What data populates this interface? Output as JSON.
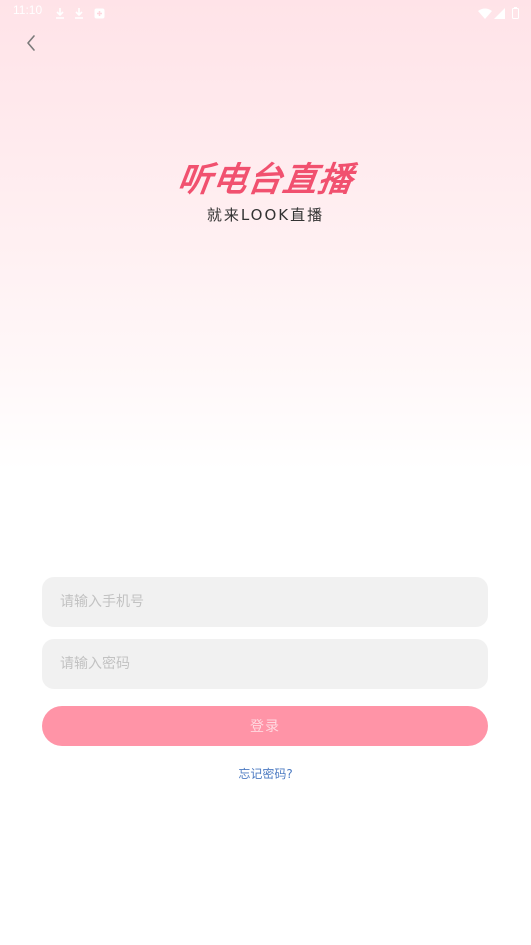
{
  "status_bar": {
    "time": "11:10",
    "icons": [
      "download-icon",
      "download-icon",
      "app-notification-icon",
      "wifi-icon",
      "signal-icon",
      "battery-icon"
    ]
  },
  "nav": {
    "back_icon": "chevron-left-icon"
  },
  "hero": {
    "title": "听电台直播",
    "subtitle": "就来LOOK直播",
    "title_color": "#f1516f"
  },
  "form": {
    "phone_placeholder": "请输入手机号",
    "phone_value": "",
    "password_placeholder": "请输入密码",
    "password_value": "",
    "login_label": "登录",
    "login_color": "#ff94a7",
    "forgot_label": "忘记密码?",
    "forgot_color": "#4d7bc2"
  }
}
